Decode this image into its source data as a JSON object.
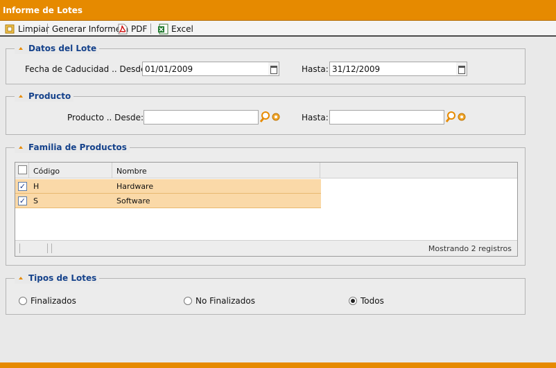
{
  "window": {
    "title": "Informe de Lotes"
  },
  "toolbar": {
    "limpiar": "Limpiar",
    "generar": "Generar Informe a",
    "pdf": "PDF",
    "excel": "Excel"
  },
  "lote": {
    "legend": "Datos del Lote",
    "desde_label": "Fecha de Caducidad .. Desde:",
    "desde_value": "01/01/2009",
    "hasta_label": "Hasta:",
    "hasta_value": "31/12/2009"
  },
  "producto": {
    "legend": "Producto",
    "desde_label": "Producto .. Desde:",
    "desde_value": "",
    "hasta_label": "Hasta:",
    "hasta_value": ""
  },
  "familia": {
    "legend": "Familia de Productos",
    "columns": {
      "codigo": "Código",
      "nombre": "Nombre"
    },
    "rows": [
      {
        "codigo": "H",
        "nombre": "Hardware",
        "checked": true
      },
      {
        "codigo": "S",
        "nombre": "Software",
        "checked": true
      }
    ],
    "footer": "Mostrando 2 registros"
  },
  "tipos": {
    "legend": "Tipos de Lotes",
    "options": [
      {
        "label": "Finalizados",
        "selected": false
      },
      {
        "label": "No Finalizados",
        "selected": false
      },
      {
        "label": "Todos",
        "selected": true
      }
    ]
  },
  "colors": {
    "accent": "#e68a00",
    "legend": "#15428b",
    "row_selected": "#fad9a8"
  }
}
